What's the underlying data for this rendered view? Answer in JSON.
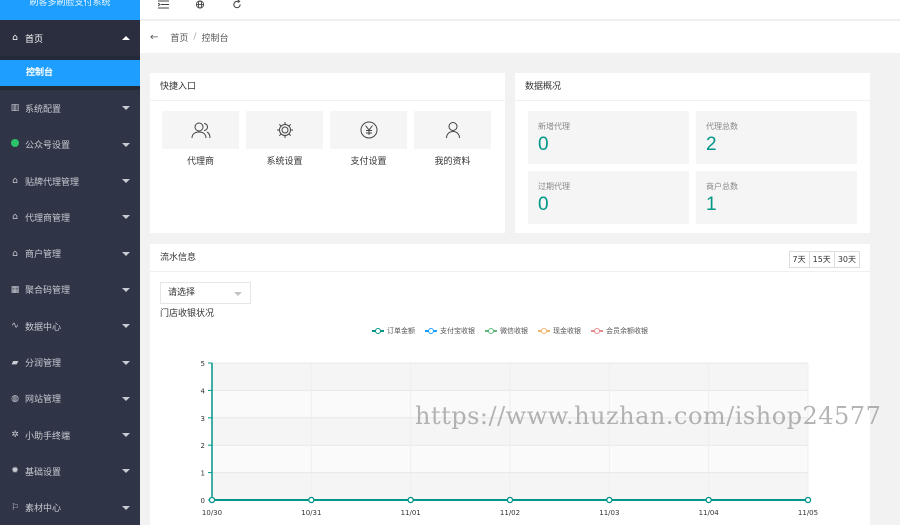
{
  "app": {
    "title": "刷客多刷脸支付系统"
  },
  "sidebar": {
    "items": [
      {
        "label": "首页",
        "icon": "home-icon",
        "glyph": "⌂",
        "open": true
      },
      {
        "label": "系统配置",
        "icon": "settings-list-icon",
        "glyph": "▥"
      },
      {
        "label": "公众号设置",
        "icon": "wechat-icon",
        "glyph": ""
      },
      {
        "label": "贴牌代理管理",
        "icon": "home-icon",
        "glyph": "⌂"
      },
      {
        "label": "代理商管理",
        "icon": "home-icon",
        "glyph": "⌂"
      },
      {
        "label": "商户管理",
        "icon": "home-icon",
        "glyph": "⌂"
      },
      {
        "label": "聚合码管理",
        "icon": "qrcode-icon",
        "glyph": "▦"
      },
      {
        "label": "数据中心",
        "icon": "pulse-icon",
        "glyph": "∿"
      },
      {
        "label": "分润管理",
        "icon": "chat-icon",
        "glyph": "▰"
      },
      {
        "label": "网站管理",
        "icon": "globe-icon",
        "glyph": "◍"
      },
      {
        "label": "小助手终端",
        "icon": "tool-icon",
        "glyph": "✲"
      },
      {
        "label": "基础设置",
        "icon": "gear-icon",
        "glyph": "✹"
      },
      {
        "label": "素材中心",
        "icon": "flag-icon",
        "glyph": "⚐"
      }
    ],
    "sub_item": "控制台"
  },
  "topbar": {
    "icons": [
      "collapse-menu-icon",
      "globe-icon",
      "refresh-icon"
    ]
  },
  "breadcrumb": {
    "home": "首页",
    "separator": "/",
    "current": "控制台"
  },
  "quick": {
    "title": "快捷入口",
    "items": [
      {
        "label": "代理商",
        "icon": "users-icon"
      },
      {
        "label": "系统设置",
        "icon": "gear-icon"
      },
      {
        "label": "支付设置",
        "icon": "yen-icon"
      },
      {
        "label": "我的资料",
        "icon": "user-icon"
      }
    ]
  },
  "overview": {
    "title": "数据概况",
    "stats": [
      {
        "label": "新增代理",
        "value": "0"
      },
      {
        "label": "代理总数",
        "value": "2"
      },
      {
        "label": "过期代理",
        "value": "0"
      },
      {
        "label": "商户总数",
        "value": "1"
      }
    ]
  },
  "flow": {
    "title": "流水信息",
    "ranges": [
      "7天",
      "15天",
      "30天"
    ],
    "select_value": "请选择",
    "shop_label": "门店收银状况"
  },
  "watermark": "https://www.huzhan.com/ishop24577",
  "colors": {
    "accent": "#1e9fff",
    "teal": "#009688",
    "sidebar": "#2f3447"
  },
  "chart_data": {
    "type": "line",
    "categories": [
      "10/30",
      "10/31",
      "11/01",
      "11/02",
      "11/03",
      "11/04",
      "11/05"
    ],
    "ylim": [
      0,
      5
    ],
    "yticks": [
      0,
      1,
      2,
      3,
      4,
      5
    ],
    "series": [
      {
        "name": "订单金额",
        "color": "#009688",
        "values": [
          0,
          0,
          0,
          0,
          0,
          0,
          0
        ]
      },
      {
        "name": "支付宝收银",
        "color": "#1e9fff",
        "values": [
          0,
          0,
          0,
          0,
          0,
          0,
          0
        ]
      },
      {
        "name": "微信收银",
        "color": "#5fb878",
        "values": [
          0,
          0,
          0,
          0,
          0,
          0,
          0
        ]
      },
      {
        "name": "现金收银",
        "color": "#f7b36b",
        "values": [
          0,
          0,
          0,
          0,
          0,
          0,
          0
        ]
      },
      {
        "name": "会员余额收银",
        "color": "#e88b8b",
        "values": [
          0,
          0,
          0,
          0,
          0,
          0,
          0
        ]
      }
    ]
  }
}
